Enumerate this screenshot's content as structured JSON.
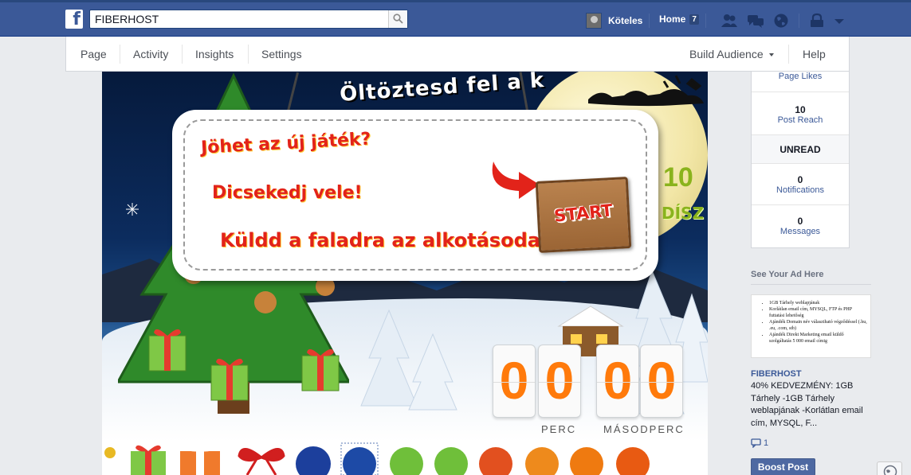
{
  "topbar": {
    "search_value": "FIBERHOST",
    "user_name": "Köteles",
    "home_label": "Home",
    "home_count": "7"
  },
  "page_nav": {
    "page": "Page",
    "activity": "Activity",
    "insights": "Insights",
    "settings": "Settings",
    "build_audience": "Build Audience",
    "help": "Help"
  },
  "game": {
    "title": "Öltöztesd fel a k",
    "line1": "Jöhet az új játék?",
    "line2": "Dicsekedj vele!",
    "line3": "Küldd a faladra az  alkotásodat!",
    "start_label": "START",
    "ornament_count": "10",
    "ornament_label": "DÍSZ",
    "timer": {
      "min_d1": "0",
      "min_d2": "0",
      "sec_d1": "0",
      "sec_d2": "0",
      "min_label": "PERC",
      "sec_label": "MÁSODPERC"
    }
  },
  "right_stats": {
    "page_likes_label": "Page Likes",
    "post_reach_num": "10",
    "post_reach_label": "Post Reach",
    "unread_label": "UNREAD",
    "notifications_num": "0",
    "notifications_label": "Notifications",
    "messages_num": "0",
    "messages_label": "Messages"
  },
  "ad": {
    "header": "See Your Ad Here",
    "image_lines": [
      "1GB Tárhely weblapjának",
      "Korlátlan email cím, MYSQL, FTP és PHP futtatási lehetőség",
      "Ajándék Domain név választható végződéssel (.hu, .eu, .com, stb)",
      "Ajándék Direkt Marketing email küldő szolgáltatás 5 000 email címig"
    ],
    "title": "FIBERHOST",
    "text": "40% KEDVEZMÉNY: 1GB Tárhely -1GB Tárhely weblapjának -Korlátlan email cím, MYSQL, F...",
    "comments": "1",
    "boost_label": "Boost Post"
  }
}
